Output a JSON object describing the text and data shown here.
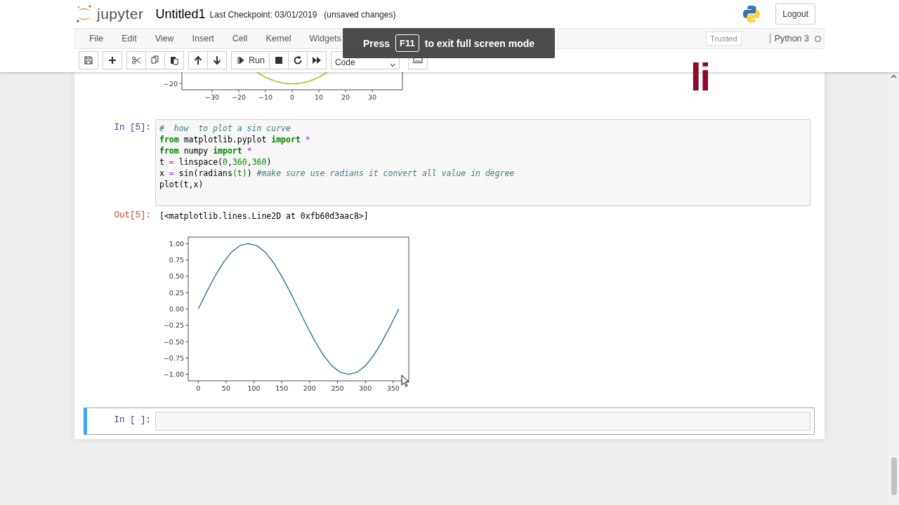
{
  "header": {
    "logo": "jupyter",
    "notebook_name": "Untitled1",
    "checkpoint": "Last Checkpoint: 03/01/2019",
    "autosave": "(unsaved changes)",
    "logout": "Logout"
  },
  "menubar": {
    "items": [
      "File",
      "Edit",
      "View",
      "Insert",
      "Cell",
      "Kernel",
      "Widgets"
    ],
    "trusted": "Trusted",
    "kernel": "Python 3",
    "kernel_busy": false
  },
  "toolbar": {
    "run": "Run",
    "cell_type": "Code"
  },
  "toast": {
    "before": "Press",
    "key": "F11",
    "after": "to exit full screen mode"
  },
  "overlay_text": "li",
  "notebook": {
    "previous_output": {
      "x_tick_labels": [
        "−30",
        "−20",
        "−10",
        "0",
        "10",
        "20",
        "30"
      ],
      "y_tick_labels": [
        "−20"
      ]
    },
    "cells": [
      {
        "prompt": "In [5]:",
        "selected": false,
        "code": [
          [
            {
              "text": "#  how  to plot a sin curve",
              "kind": "comment"
            }
          ],
          [
            {
              "text": "from",
              "kind": "kw"
            },
            {
              "text": " matplotlib.pyplot ",
              "kind": "plain"
            },
            {
              "text": "import",
              "kind": "kw"
            },
            {
              "text": " *",
              "kind": "op"
            }
          ],
          [
            {
              "text": "from",
              "kind": "kw"
            },
            {
              "text": " numpy ",
              "kind": "plain"
            },
            {
              "text": "import",
              "kind": "kw"
            },
            {
              "text": " *",
              "kind": "op"
            }
          ],
          [
            {
              "text": "t ",
              "kind": "plain"
            },
            {
              "text": "=",
              "kind": "op"
            },
            {
              "text": " linspace(",
              "kind": "plain"
            },
            {
              "text": "0",
              "kind": "num"
            },
            {
              "text": ",",
              "kind": "plain"
            },
            {
              "text": "360",
              "kind": "num"
            },
            {
              "text": ",",
              "kind": "plain"
            },
            {
              "text": "360",
              "kind": "num"
            },
            {
              "text": ")",
              "kind": "plain"
            }
          ],
          [
            {
              "text": "x ",
              "kind": "plain"
            },
            {
              "text": "=",
              "kind": "op"
            },
            {
              "text": " sin(radians",
              "kind": "plain"
            },
            {
              "text": "(t)",
              "kind": "num"
            },
            {
              "text": ") ",
              "kind": "plain"
            },
            {
              "text": "#make sure use radians it convert all value in degree",
              "kind": "comment"
            }
          ],
          [
            {
              "text": "plot(t,x)",
              "kind": "plain"
            }
          ]
        ],
        "output_prompt": "Out[5]:",
        "output_text": "[<matplotlib.lines.Line2D at 0xfb60d3aac8>]",
        "chart_data": {
          "type": "line",
          "xlim": [
            -18,
            378
          ],
          "ylim": [
            -1.1,
            1.1
          ],
          "xticks": [
            0,
            50,
            100,
            150,
            200,
            250,
            300,
            350
          ],
          "yticks": [
            {
              "value": 1,
              "label": "1.00"
            },
            {
              "value": 0.75,
              "label": "0.75"
            },
            {
              "value": 0.5,
              "label": "0.50"
            },
            {
              "value": 0.25,
              "label": "0.25"
            },
            {
              "value": 0,
              "label": "0.00"
            },
            {
              "value": -0.25,
              "label": "−0.25"
            },
            {
              "value": -0.5,
              "label": "−0.50"
            },
            {
              "value": -0.75,
              "label": "−0.75"
            },
            {
              "value": -1,
              "label": "−1.00"
            }
          ],
          "x": [
            0,
            15,
            30,
            45,
            60,
            75,
            90,
            105,
            120,
            135,
            150,
            165,
            180,
            195,
            210,
            225,
            240,
            255,
            270,
            285,
            300,
            315,
            330,
            345,
            360
          ],
          "series": [
            {
              "color": "#3b7ea1",
              "values": [
                0,
                0.26,
                0.5,
                0.71,
                0.87,
                0.97,
                1,
                0.97,
                0.87,
                0.71,
                0.5,
                0.26,
                0,
                -0.26,
                -0.5,
                -0.71,
                -0.87,
                -0.97,
                -1,
                -0.97,
                -0.87,
                -0.71,
                -0.5,
                -0.26,
                0
              ]
            }
          ]
        }
      },
      {
        "prompt": "In [ ]:",
        "selected": true
      }
    ]
  }
}
